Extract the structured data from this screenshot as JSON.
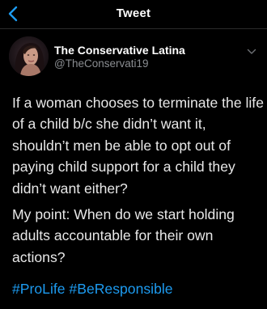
{
  "header": {
    "title": "Tweet",
    "back_icon": "chevron-left-icon"
  },
  "author": {
    "name": "The Conservative Latina",
    "handle": "@TheConservati19",
    "menu_icon": "chevron-down-icon"
  },
  "tweet": {
    "paragraph_1": "If a woman chooses to terminate the life of a child b/c she didn’t want it, shouldn’t men be able to opt out of paying child support for a child they didn’t want either?",
    "paragraph_2": "My point: When do we start holding adults accountable for their own actions?",
    "hashtags": [
      "#ProLife",
      "#BeResponsible"
    ]
  },
  "colors": {
    "background": "#000000",
    "text": "#e8e8e8",
    "secondary_text": "#8a8d91",
    "accent": "#1d9bf0"
  }
}
